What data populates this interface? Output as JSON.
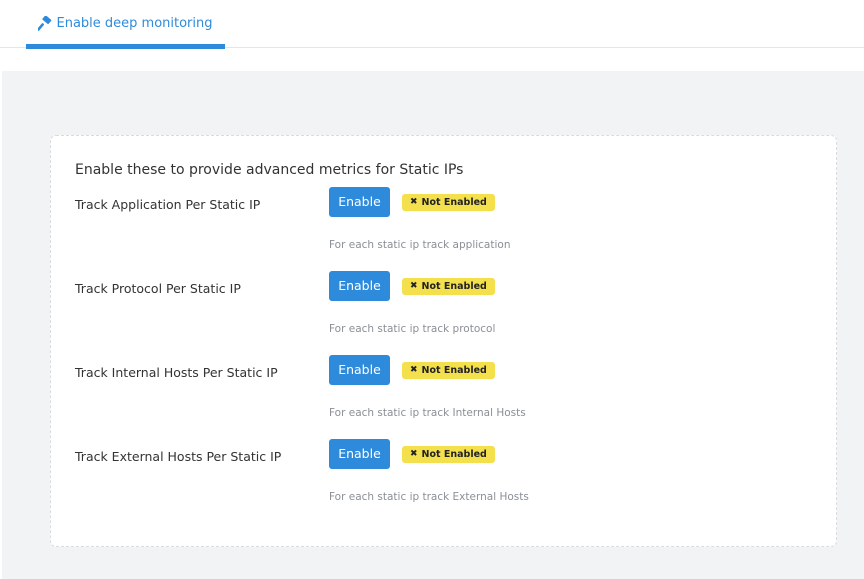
{
  "tab": {
    "label": "Enable deep monitoring",
    "icon": "hammer-icon"
  },
  "card": {
    "heading": "Enable these to provide advanced metrics for Static IPs",
    "button_label": "Enable",
    "status_icon": "✖",
    "status_label": "Not Enabled",
    "rows": [
      {
        "label": "Track Application Per Static IP",
        "help": "For each static ip track application"
      },
      {
        "label": "Track Protocol Per Static IP",
        "help": "For each static ip track protocol"
      },
      {
        "label": "Track Internal Hosts Per Static IP",
        "help": "For each static ip track Internal Hosts"
      },
      {
        "label": "Track External Hosts Per Static IP",
        "help": "For each static ip track External Hosts"
      }
    ]
  },
  "colors": {
    "accent": "#2e8bdc",
    "badge": "#f4e04d",
    "page_bg": "#f2f3f5"
  }
}
